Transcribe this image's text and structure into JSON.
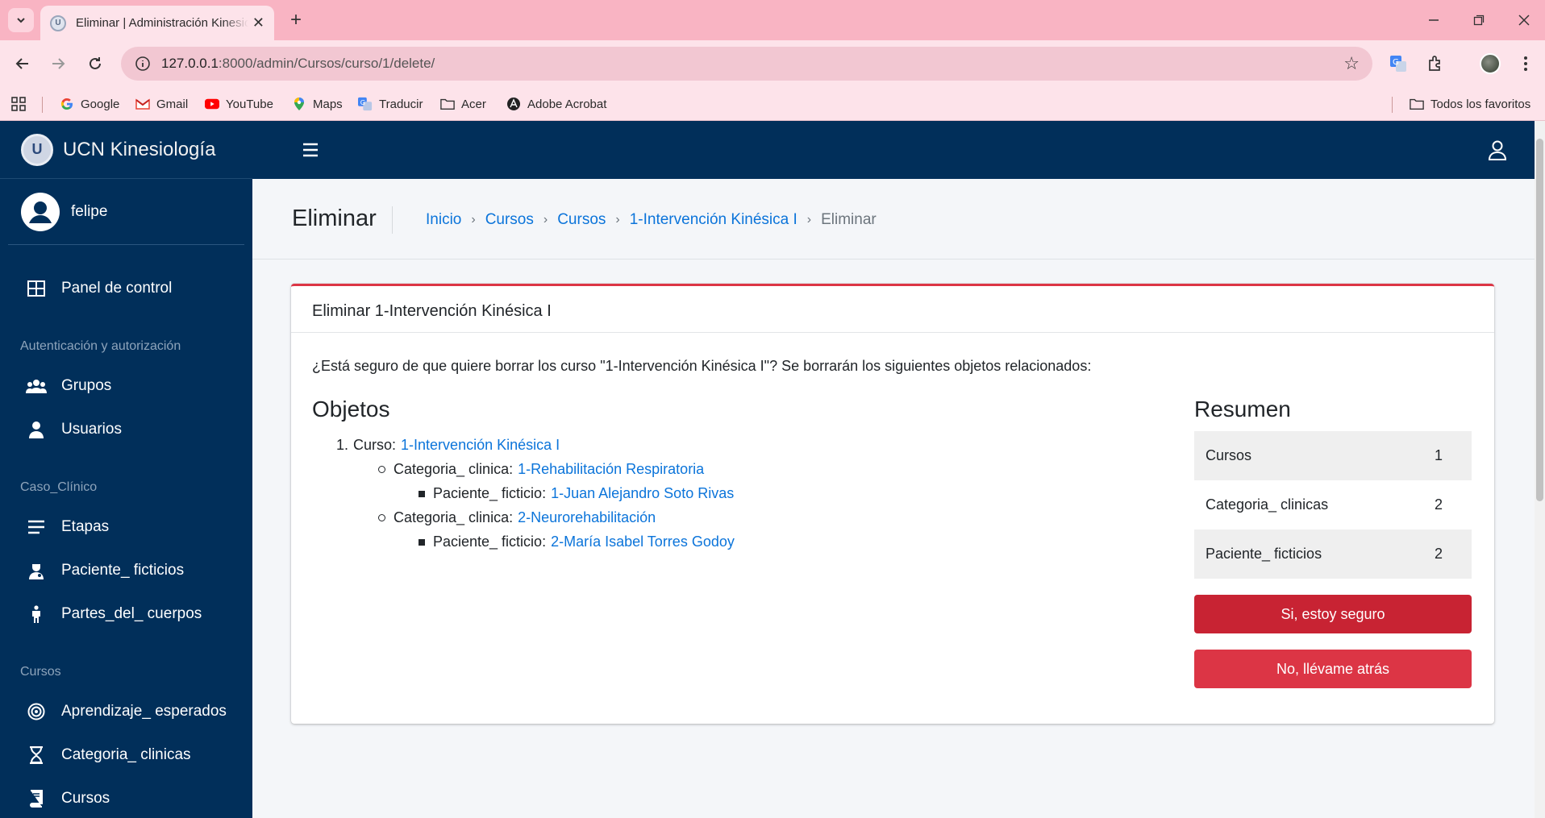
{
  "browser": {
    "tab_title": "Eliminar | Administración Kinesiología",
    "tab_favicon": "U",
    "url_host": "127.0.0.1",
    "url_rest": ":8000/admin/Cursos/curso/1/delete/",
    "bookmarks": [
      {
        "label": "Google",
        "icon": "google-icon"
      },
      {
        "label": "Gmail",
        "icon": "gmail-icon"
      },
      {
        "label": "YouTube",
        "icon": "youtube-icon"
      },
      {
        "label": "Maps",
        "icon": "maps-icon"
      },
      {
        "label": "Traducir",
        "icon": "translate-icon"
      },
      {
        "label": "Acer",
        "icon": "folder-icon"
      },
      {
        "label": "Adobe Acrobat",
        "icon": "acrobat-icon"
      }
    ],
    "all_bookmarks": "Todos los favoritos"
  },
  "sidebar": {
    "brand": "UCN Kinesiología",
    "brand_logo": "U",
    "user": "felipe",
    "dashboard": "Panel de control",
    "groups": [
      {
        "header": "Autenticación y autorización",
        "items": [
          "Grupos",
          "Usuarios"
        ]
      },
      {
        "header": "Caso_Clínico",
        "items": [
          "Etapas",
          "Paciente_ ficticios",
          "Partes_del_ cuerpos"
        ]
      },
      {
        "header": "Cursos",
        "items": [
          "Aprendizaje_ esperados",
          "Categoria_ clinicas",
          "Cursos"
        ]
      }
    ]
  },
  "header": {
    "title": "Eliminar",
    "breadcrumb": [
      "Inicio",
      "Cursos",
      "Cursos",
      "1-Intervención Kinésica I"
    ],
    "breadcrumb_current": "Eliminar",
    "separator": "›"
  },
  "card": {
    "title": "Eliminar 1-Intervención Kinésica I",
    "confirm_text": "¿Está seguro de que quiere borrar los curso \"1-Intervención Kinésica I\"? Se borrarán los siguientes objetos relacionados:",
    "objects_heading": "Objetos",
    "objects": {
      "item_number": "1.",
      "course_label": "Curso:",
      "course_link": "1-Intervención Kinésica I",
      "categories": [
        {
          "label": "Categoria_ clinica:",
          "link": "1-Rehabilitación Respiratoria",
          "patient_label": "Paciente_ ficticio:",
          "patient_link": "1-Juan Alejandro Soto Rivas"
        },
        {
          "label": "Categoria_ clinica:",
          "link": "2-Neurorehabilitación",
          "patient_label": "Paciente_ ficticio:",
          "patient_link": "2-María Isabel Torres Godoy"
        }
      ]
    },
    "summary_heading": "Resumen",
    "summary": [
      {
        "label": "Cursos",
        "value": "1"
      },
      {
        "label": "Categoria_ clinicas",
        "value": "2"
      },
      {
        "label": "Paciente_ ficticios",
        "value": "2"
      }
    ],
    "confirm_button": "Si, estoy seguro",
    "back_button": "No, llévame atrás"
  },
  "colors": {
    "sidebar_bg": "#012f5a",
    "danger": "#dc3545",
    "link": "#0b74da",
    "browser_frame": "#f9b4c3"
  }
}
